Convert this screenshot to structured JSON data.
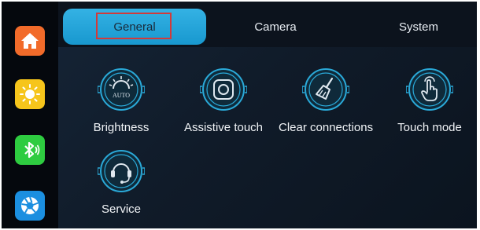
{
  "tabs": {
    "general": "General",
    "camera": "Camera",
    "system": "System"
  },
  "settings": {
    "brightness": {
      "label": "Brightness",
      "icon": "brightness-auto-icon",
      "icon_text": "AUTO"
    },
    "assistive_touch": {
      "label": "Assistive touch",
      "icon": "assistive-touch-icon"
    },
    "clear_connections": {
      "label": "Clear connections",
      "icon": "broom-icon"
    },
    "touch_mode": {
      "label": "Touch mode",
      "icon": "touch-hand-icon"
    },
    "service": {
      "label": "Service",
      "icon": "headset-icon"
    }
  },
  "sidebar": {
    "items": [
      {
        "name": "home",
        "icon": "home-icon",
        "color": "#f26b2a"
      },
      {
        "name": "brightness",
        "icon": "sun-icon",
        "color": "#f6c51b"
      },
      {
        "name": "bluetooth",
        "icon": "bluetooth-icon",
        "color": "#2ecc40"
      },
      {
        "name": "camera",
        "icon": "aperture-icon",
        "color": "#1b8fe0"
      }
    ]
  },
  "colors": {
    "accent": "#1ea3dc",
    "highlight_box": "#d23a3a",
    "icon_cyan": "#2aa9d8"
  }
}
